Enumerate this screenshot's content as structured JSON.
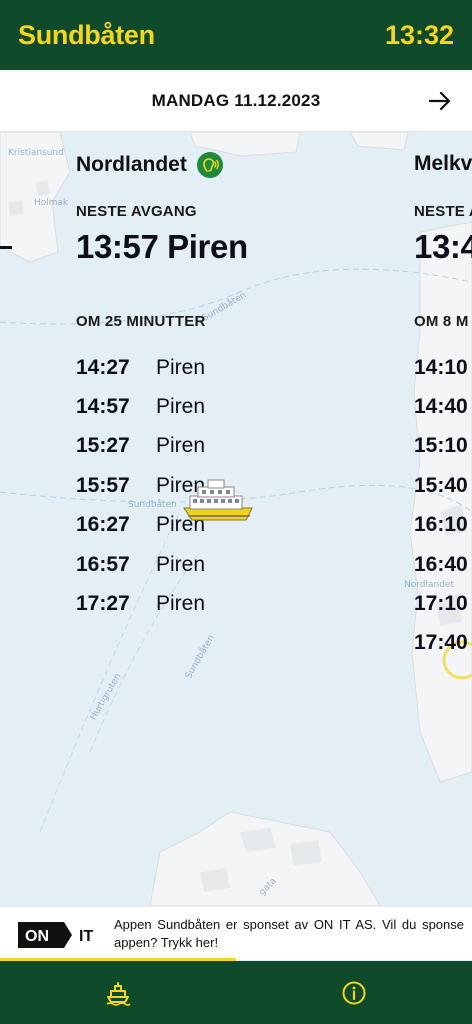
{
  "header": {
    "title": "Sundbåten",
    "clock": "13:32"
  },
  "date_bar": {
    "date": "MANDAG 11.12.2023",
    "next_icon": "arrow-right-icon"
  },
  "map_labels": {
    "kristiansund": "Kristiansund",
    "holmak": "Holmak",
    "sundbaten": "Sundbåten",
    "hurtigruten": "Hurtigruten",
    "nordlandet": "Nordlandet",
    "gata": "gata"
  },
  "routes": [
    {
      "name": "Nordlandet",
      "realtime_icon": "realtime-signal-icon",
      "next_label": "NESTE AVGANG",
      "next_departure": "13:57 Piren",
      "minutes_label": "OM 25 MINUTTER",
      "departures": [
        {
          "time": "14:27",
          "place": "Piren"
        },
        {
          "time": "14:57",
          "place": "Piren"
        },
        {
          "time": "15:27",
          "place": "Piren"
        },
        {
          "time": "15:57",
          "place": "Piren"
        },
        {
          "time": "16:27",
          "place": "Piren"
        },
        {
          "time": "16:57",
          "place": "Piren"
        },
        {
          "time": "17:27",
          "place": "Piren"
        }
      ]
    },
    {
      "name": "Melkv",
      "next_label": "NESTE A",
      "next_departure": "13:4",
      "minutes_label": "OM 8 M",
      "departures": [
        {
          "time": "14:10"
        },
        {
          "time": "14:40"
        },
        {
          "time": "15:10"
        },
        {
          "time": "15:40"
        },
        {
          "time": "16:10"
        },
        {
          "time": "16:40"
        },
        {
          "time": "17:10"
        },
        {
          "time": "17:40"
        }
      ]
    }
  ],
  "sponsor": {
    "logo_text_on": "ON",
    "logo_text_it": "IT",
    "text": "Appen Sundbåten er sponset av ON IT AS. Vil du sponse appen? Trykk her!",
    "progress": 0.5
  },
  "nav": [
    {
      "icon": "ferry-icon"
    },
    {
      "icon": "info-icon"
    }
  ],
  "colors": {
    "brand_green": "#0f4a2a",
    "brand_yellow": "#f7d51f",
    "realtime_green": "#1f8a3a",
    "water": "#e3eff4",
    "land": "#f3f4f5"
  }
}
